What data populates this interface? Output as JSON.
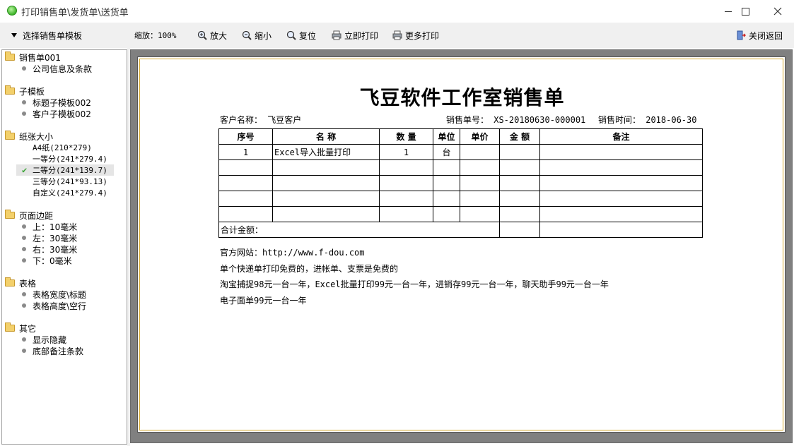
{
  "window": {
    "title": "打印销售单\\发货单\\送货单"
  },
  "toolbar": {
    "template_select": "选择销售单模板",
    "zoom_label": "缩放：100%",
    "zoom_in": "放大",
    "zoom_out": "缩小",
    "reset": "复位",
    "print_now": "立即打印",
    "more_print": "更多打印",
    "close_return": "关闭返回"
  },
  "tree": [
    {
      "label": "销售单001",
      "items": [
        "公司信息及条款"
      ]
    },
    {
      "label": "子模板",
      "items": [
        "标题子模板002",
        "客户子模板002"
      ]
    },
    {
      "label": "纸张大小",
      "items": [
        "A4纸(210*279)",
        "一等分(241*279.4)",
        "二等分(241*139.7)",
        "三等分(241*93.13)",
        "自定义(241*279.4)"
      ]
    },
    {
      "label": "页面边距",
      "items": [
        "上：10毫米",
        "左：30毫米",
        "右：30毫米",
        "下：0毫米"
      ]
    },
    {
      "label": "表格",
      "items": [
        "表格宽度\\标题",
        "表格高度\\空行"
      ]
    },
    {
      "label": "其它",
      "items": [
        "显示隐藏",
        "底部备注条款"
      ]
    }
  ],
  "document": {
    "title": "飞豆软件工作室销售单",
    "customer": "客户名称： 飞豆客户",
    "order_no": "销售单号： XS-20180630-000001",
    "order_time": "销售时间： 2018-06-30",
    "headers": [
      "序号",
      "名 称",
      "数 量",
      "单位",
      "单价",
      "金 额",
      "备注"
    ],
    "rows": [
      [
        "1",
        "Excel导入批量打印",
        "1",
        "台",
        "",
        "",
        ""
      ],
      [
        "",
        "",
        "",
        "",
        "",
        "",
        ""
      ],
      [
        "",
        "",
        "",
        "",
        "",
        "",
        ""
      ],
      [
        "",
        "",
        "",
        "",
        "",
        "",
        ""
      ],
      [
        "",
        "",
        "",
        "",
        "",
        "",
        ""
      ]
    ],
    "total_label": "合计金额：",
    "notes": [
      "官方网站：http://www.f-dou.com",
      "单个快递单打印免费的，进帐单、支票是免费的",
      "淘宝捕捉98元一台一年，Excel批量打印99元一台一年，进销存99元一台一年，聊天助手99元一台一年",
      "电子面单99元一台一年"
    ]
  }
}
